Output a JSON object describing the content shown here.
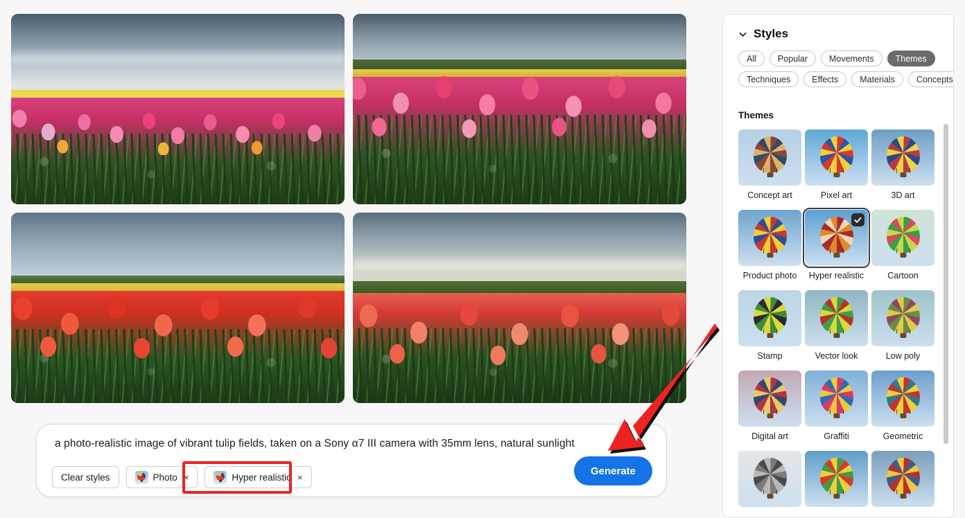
{
  "results": {
    "images": [
      {
        "alt": "Tulip field with pink and red tulips under hazy sky",
        "palette": "pink"
      },
      {
        "alt": "Close-up rows of pink and red tulips with tree line",
        "palette": "pink-rows"
      },
      {
        "alt": "Red tulip field with long furrow rows and blue sky",
        "palette": "red"
      },
      {
        "alt": "Red and pink tulip field stretching to horizon",
        "palette": "red-pink"
      }
    ]
  },
  "prompt_bar": {
    "prompt_text": "a photo-realistic image of vibrant tulip fields, taken on a Sony α7 III camera with 35mm lens, natural sunlight",
    "clear_styles_label": "Clear styles",
    "chips": [
      {
        "label": "Photo",
        "remove_label": "×"
      },
      {
        "label": "Hyper realistic",
        "remove_label": "×"
      }
    ],
    "generate_label": "Generate"
  },
  "annotation": {
    "arrow_color": "#ee2222",
    "highlight_color": "#ee2222"
  },
  "styles_panel": {
    "title": "Styles",
    "collapse_icon": "chevron-down-icon",
    "filters": [
      {
        "label": "All",
        "active": false
      },
      {
        "label": "Popular",
        "active": false
      },
      {
        "label": "Movements",
        "active": false
      },
      {
        "label": "Themes",
        "active": true
      },
      {
        "label": "Techniques",
        "active": false
      },
      {
        "label": "Effects",
        "active": false
      },
      {
        "label": "Materials",
        "active": false
      },
      {
        "label": "Concepts",
        "active": false
      }
    ],
    "section_label": "Themes",
    "styles": [
      {
        "label": "Concept art",
        "selected": false,
        "sky": "#b6cfe4",
        "c1": "#d8b46a",
        "c2": "#8c4634",
        "c3": "#2f4a6b"
      },
      {
        "label": "Pixel art",
        "selected": false,
        "sky": "#5fa8d8",
        "c1": "#f2d23a",
        "c2": "#d8392b",
        "c3": "#2f53a8"
      },
      {
        "label": "3D art",
        "selected": false,
        "sky": "#6d9fc4",
        "c1": "#f0d341",
        "c2": "#b53a4a",
        "c3": "#2a4a86"
      },
      {
        "label": "Product photo",
        "selected": false,
        "sky": "#6fa4cf",
        "c1": "#f2cd3a",
        "c2": "#c23a33",
        "c3": "#2b4f92"
      },
      {
        "label": "Hyper realistic",
        "selected": true,
        "sky": "#5e9fd2",
        "c1": "#e08a2a",
        "c2": "#a62c2c",
        "c3": "#e7d9b8"
      },
      {
        "label": "Cartoon",
        "selected": false,
        "sky": "#cfe3d6",
        "c1": "#c7d94a",
        "c2": "#3f9c4a",
        "c3": "#d94a5c"
      },
      {
        "label": "Stamp",
        "selected": false,
        "sky": "#bcd6e4",
        "c1": "#d8d93a",
        "c2": "#3f8c3a",
        "c3": "#2b2b2b"
      },
      {
        "label": "Vector look",
        "selected": false,
        "sky": "#8fb6c4",
        "c1": "#d8d93a",
        "c2": "#3f9c4a",
        "c3": "#b7312b"
      },
      {
        "label": "Low poly",
        "selected": false,
        "sky": "#9fc3cd",
        "c1": "#e0cb4a",
        "c2": "#6a8c4a",
        "c3": "#8c4a5c"
      },
      {
        "label": "Digital art",
        "selected": false,
        "sky": "#c4a8b6",
        "c1": "#e8c86a",
        "c2": "#b3344a",
        "c3": "#2f4a6b"
      },
      {
        "label": "Graffiti",
        "selected": false,
        "sky": "#7fb0d8",
        "c1": "#f0c83a",
        "c2": "#d8396b",
        "c3": "#2f6bb5"
      },
      {
        "label": "Geometric",
        "selected": false,
        "sky": "#6d9fcd",
        "c1": "#f0cf3a",
        "c2": "#c2342f",
        "c3": "#2f7a8c"
      },
      {
        "label": "",
        "selected": false,
        "sky": "#e3e6e8",
        "c1": "#b8b8b8",
        "c2": "#7a7a7a",
        "c3": "#4a4a4a"
      },
      {
        "label": "",
        "selected": false,
        "sky": "#5f9fc8",
        "c1": "#f0cf3a",
        "c2": "#3f9c4a",
        "c3": "#d8392b"
      },
      {
        "label": "",
        "selected": false,
        "sky": "#7a9ebc",
        "c1": "#f0c83a",
        "c2": "#b7312b",
        "c3": "#3f5c8c"
      }
    ]
  }
}
